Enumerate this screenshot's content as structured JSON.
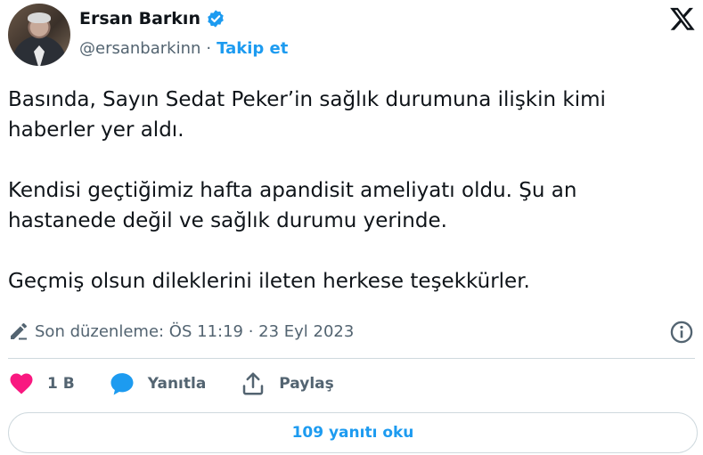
{
  "author": {
    "name": "Ersan Barkın",
    "handle": "@ersanbarkinn",
    "separator": "·",
    "follow_label": "Takip et"
  },
  "tweet": {
    "paragraphs": [
      [
        "Basında, Sayın Sedat Peker’in sağlık durumuna ilişkin kimi",
        "haberler yer aldı."
      ],
      [
        "Kendisi geçtiğimiz hafta apandisit ameliyatı oldu. Şu an",
        "hastanede değil ve sağlık durumu yerinde."
      ],
      [
        "Geçmiş olsun dileklerini ileten herkese teşekkürler."
      ]
    ],
    "edited_text": "Son düzenleme: ÖS 11:19 · 23 Eyl 2023"
  },
  "actions": {
    "like_count": "1 B",
    "reply_label": "Yanıtla",
    "share_label": "Paylaş"
  },
  "read_replies_label": "109 yanıtı oku",
  "icons": {
    "verified": "verified-badge-icon",
    "x_logo": "x-logo-icon",
    "edit": "pencil-icon",
    "info": "info-icon",
    "like": "heart-icon",
    "reply": "speech-bubble-icon",
    "share": "share-upload-icon"
  },
  "colors": {
    "accent": "#1d9bf0",
    "like": "#f91880",
    "text": "#0f1419",
    "muted": "#536471",
    "border": "#cfd9de"
  }
}
